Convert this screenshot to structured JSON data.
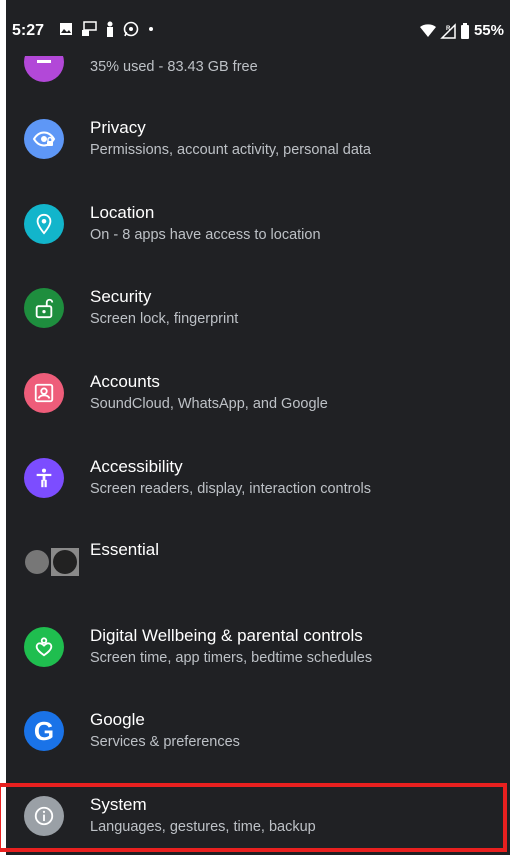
{
  "status_bar": {
    "time": "5:27",
    "left_icons": [
      "image-icon",
      "cast-icon",
      "person-icon",
      "whatsapp-icon",
      "dot-icon"
    ],
    "right_icons": [
      "wifi-icon",
      "signal-icon",
      "battery-icon"
    ],
    "battery": "55%"
  },
  "storage": {
    "subtitle": "35% used - 83.43 GB free",
    "icon": "storage-icon",
    "icon_color": "#b248d8"
  },
  "items": [
    {
      "title": "Privacy",
      "subtitle": "Permissions, account activity, personal data",
      "icon": "privacy-eye-icon",
      "color": "#5e97f6"
    },
    {
      "title": "Location",
      "subtitle": "On - 8 apps have access to location",
      "icon": "location-pin-icon",
      "color": "#12b5cb"
    },
    {
      "title": "Security",
      "subtitle": "Screen lock, fingerprint",
      "icon": "unlock-icon",
      "color": "#1e8e3e"
    },
    {
      "title": "Accounts",
      "subtitle": "SoundCloud, WhatsApp, and Google",
      "icon": "account-box-icon",
      "color": "#ee5d7a"
    },
    {
      "title": "Accessibility",
      "subtitle": "Screen readers, display, interaction controls",
      "icon": "accessibility-icon",
      "color": "#7c4dff"
    },
    {
      "title": "Essential",
      "subtitle": "",
      "icon": "essential-logo-icon",
      "color": "#777777"
    },
    {
      "title": "Digital Wellbeing & parental controls",
      "subtitle": "Screen time, app timers, bedtime schedules",
      "icon": "wellbeing-heart-icon",
      "color": "#1fbe4f"
    },
    {
      "title": "Google",
      "subtitle": "Services & preferences",
      "icon": "google-g-icon",
      "color": "#1a73e8"
    },
    {
      "title": "System",
      "subtitle": "Languages, gestures, time, backup",
      "icon": "info-icon",
      "color": "#9aa0a6"
    }
  ]
}
